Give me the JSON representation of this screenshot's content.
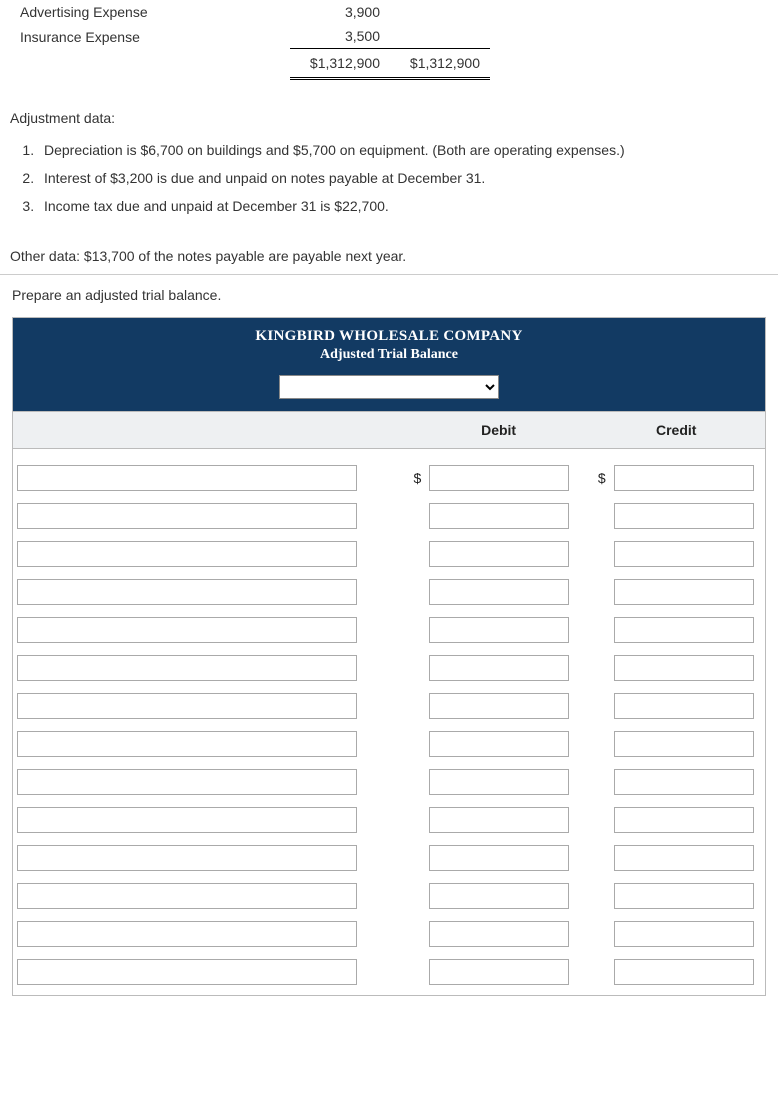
{
  "ledger": {
    "rows": [
      {
        "name": "Advertising Expense",
        "debit": "3,900",
        "credit": ""
      },
      {
        "name": "Insurance Expense",
        "debit": "3,500",
        "credit": ""
      }
    ],
    "total_debit": "$1,312,900",
    "total_credit": "$1,312,900"
  },
  "adjustment_heading": "Adjustment data:",
  "adjustments": [
    "Depreciation is $6,700 on buildings and $5,700 on equipment. (Both are operating expenses.)",
    "Interest of $3,200 is due and unpaid on notes payable at December 31.",
    "Income tax due and unpaid at December 31 is $22,700."
  ],
  "other_data": "Other data: $13,700 of the notes payable are payable next year.",
  "prepare_text": "Prepare an adjusted trial balance.",
  "worksheet": {
    "company": "KINGBIRD WHOLESALE COMPANY",
    "title": "Adjusted Trial Balance",
    "col_debit": "Debit",
    "col_credit": "Credit",
    "currency": "$",
    "row_count": 14
  }
}
